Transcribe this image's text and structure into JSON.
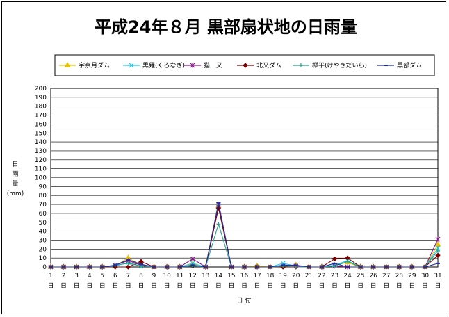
{
  "chart_data": {
    "type": "line",
    "title": "平成24年８月 黒部扇状地の日雨量",
    "ylabel_chars": [
      "日",
      "雨",
      "量"
    ],
    "ylabel_unit": "(mm)",
    "xlabel": "日 付",
    "ylim": [
      0,
      200
    ],
    "y_ticks": [
      "0",
      "10",
      "20",
      "30",
      "40",
      "50",
      "60",
      "70",
      "80",
      "90",
      "100",
      "110",
      "120",
      "130",
      "140",
      "150",
      "160",
      "170",
      "180",
      "190",
      "200"
    ],
    "grid": "horizontal",
    "legend_position": "top",
    "categories": [
      "1",
      "2",
      "3",
      "4",
      "5",
      "6",
      "7",
      "8",
      "9",
      "10",
      "11",
      "12",
      "13",
      "14",
      "15",
      "16",
      "17",
      "18",
      "19",
      "20",
      "21",
      "22",
      "23",
      "24",
      "25",
      "26",
      "27",
      "28",
      "29",
      "30",
      "31"
    ],
    "day_suffix": "日",
    "series": [
      {
        "name": "宇奈月ダム",
        "color": "#e6c200",
        "marker": "triangle",
        "values": [
          0,
          0,
          0,
          0,
          0,
          1,
          10,
          2,
          0,
          0,
          0,
          3,
          0,
          68,
          0,
          0,
          1,
          0,
          1,
          2,
          0,
          0,
          2,
          5,
          0,
          0,
          0,
          0,
          0,
          0,
          25
        ]
      },
      {
        "name": "黒薙(くろなぎ)",
        "color": "#22c8e8",
        "marker": "x",
        "values": [
          0,
          0,
          0,
          0,
          0,
          1,
          5,
          1,
          0,
          0,
          0,
          4,
          0,
          67,
          0,
          0,
          0,
          0,
          4,
          1,
          0,
          0,
          2,
          7,
          0,
          0,
          0,
          0,
          0,
          0,
          21
        ]
      },
      {
        "name": "猫　又",
        "color": "#8b1a8b",
        "marker": "star",
        "values": [
          0,
          0,
          0,
          0,
          0,
          2,
          7,
          2,
          0,
          0,
          0,
          9,
          0,
          70,
          0,
          0,
          0,
          0,
          1,
          1,
          0,
          0,
          1,
          0,
          0,
          0,
          0,
          0,
          0,
          0,
          31
        ]
      },
      {
        "name": "北又ダム",
        "color": "#7a0000",
        "marker": "diamond",
        "values": [
          0,
          0,
          0,
          0,
          0,
          0,
          0,
          6,
          0,
          0,
          0,
          1,
          0,
          66,
          0,
          0,
          0,
          0,
          0,
          0,
          0,
          0,
          9,
          10,
          0,
          0,
          0,
          0,
          0,
          0,
          13
        ]
      },
      {
        "name": "欅平(けやきだいら)",
        "color": "#2aa08a",
        "marker": "plus",
        "values": [
          0,
          0,
          0,
          0,
          0,
          2,
          4,
          1,
          0,
          0,
          0,
          1,
          0,
          48,
          0,
          0,
          0,
          0,
          1,
          0,
          0,
          0,
          1,
          6,
          0,
          0,
          0,
          0,
          0,
          0,
          18
        ]
      },
      {
        "name": "黒部ダム",
        "color": "#1f2ea0",
        "marker": "dash",
        "values": [
          0,
          0,
          0,
          0,
          0,
          2,
          8,
          3,
          0,
          0,
          0,
          2,
          0,
          72,
          0,
          0,
          0,
          0,
          2,
          2,
          0,
          0,
          4,
          0,
          0,
          0,
          0,
          0,
          0,
          0,
          4
        ]
      }
    ]
  }
}
